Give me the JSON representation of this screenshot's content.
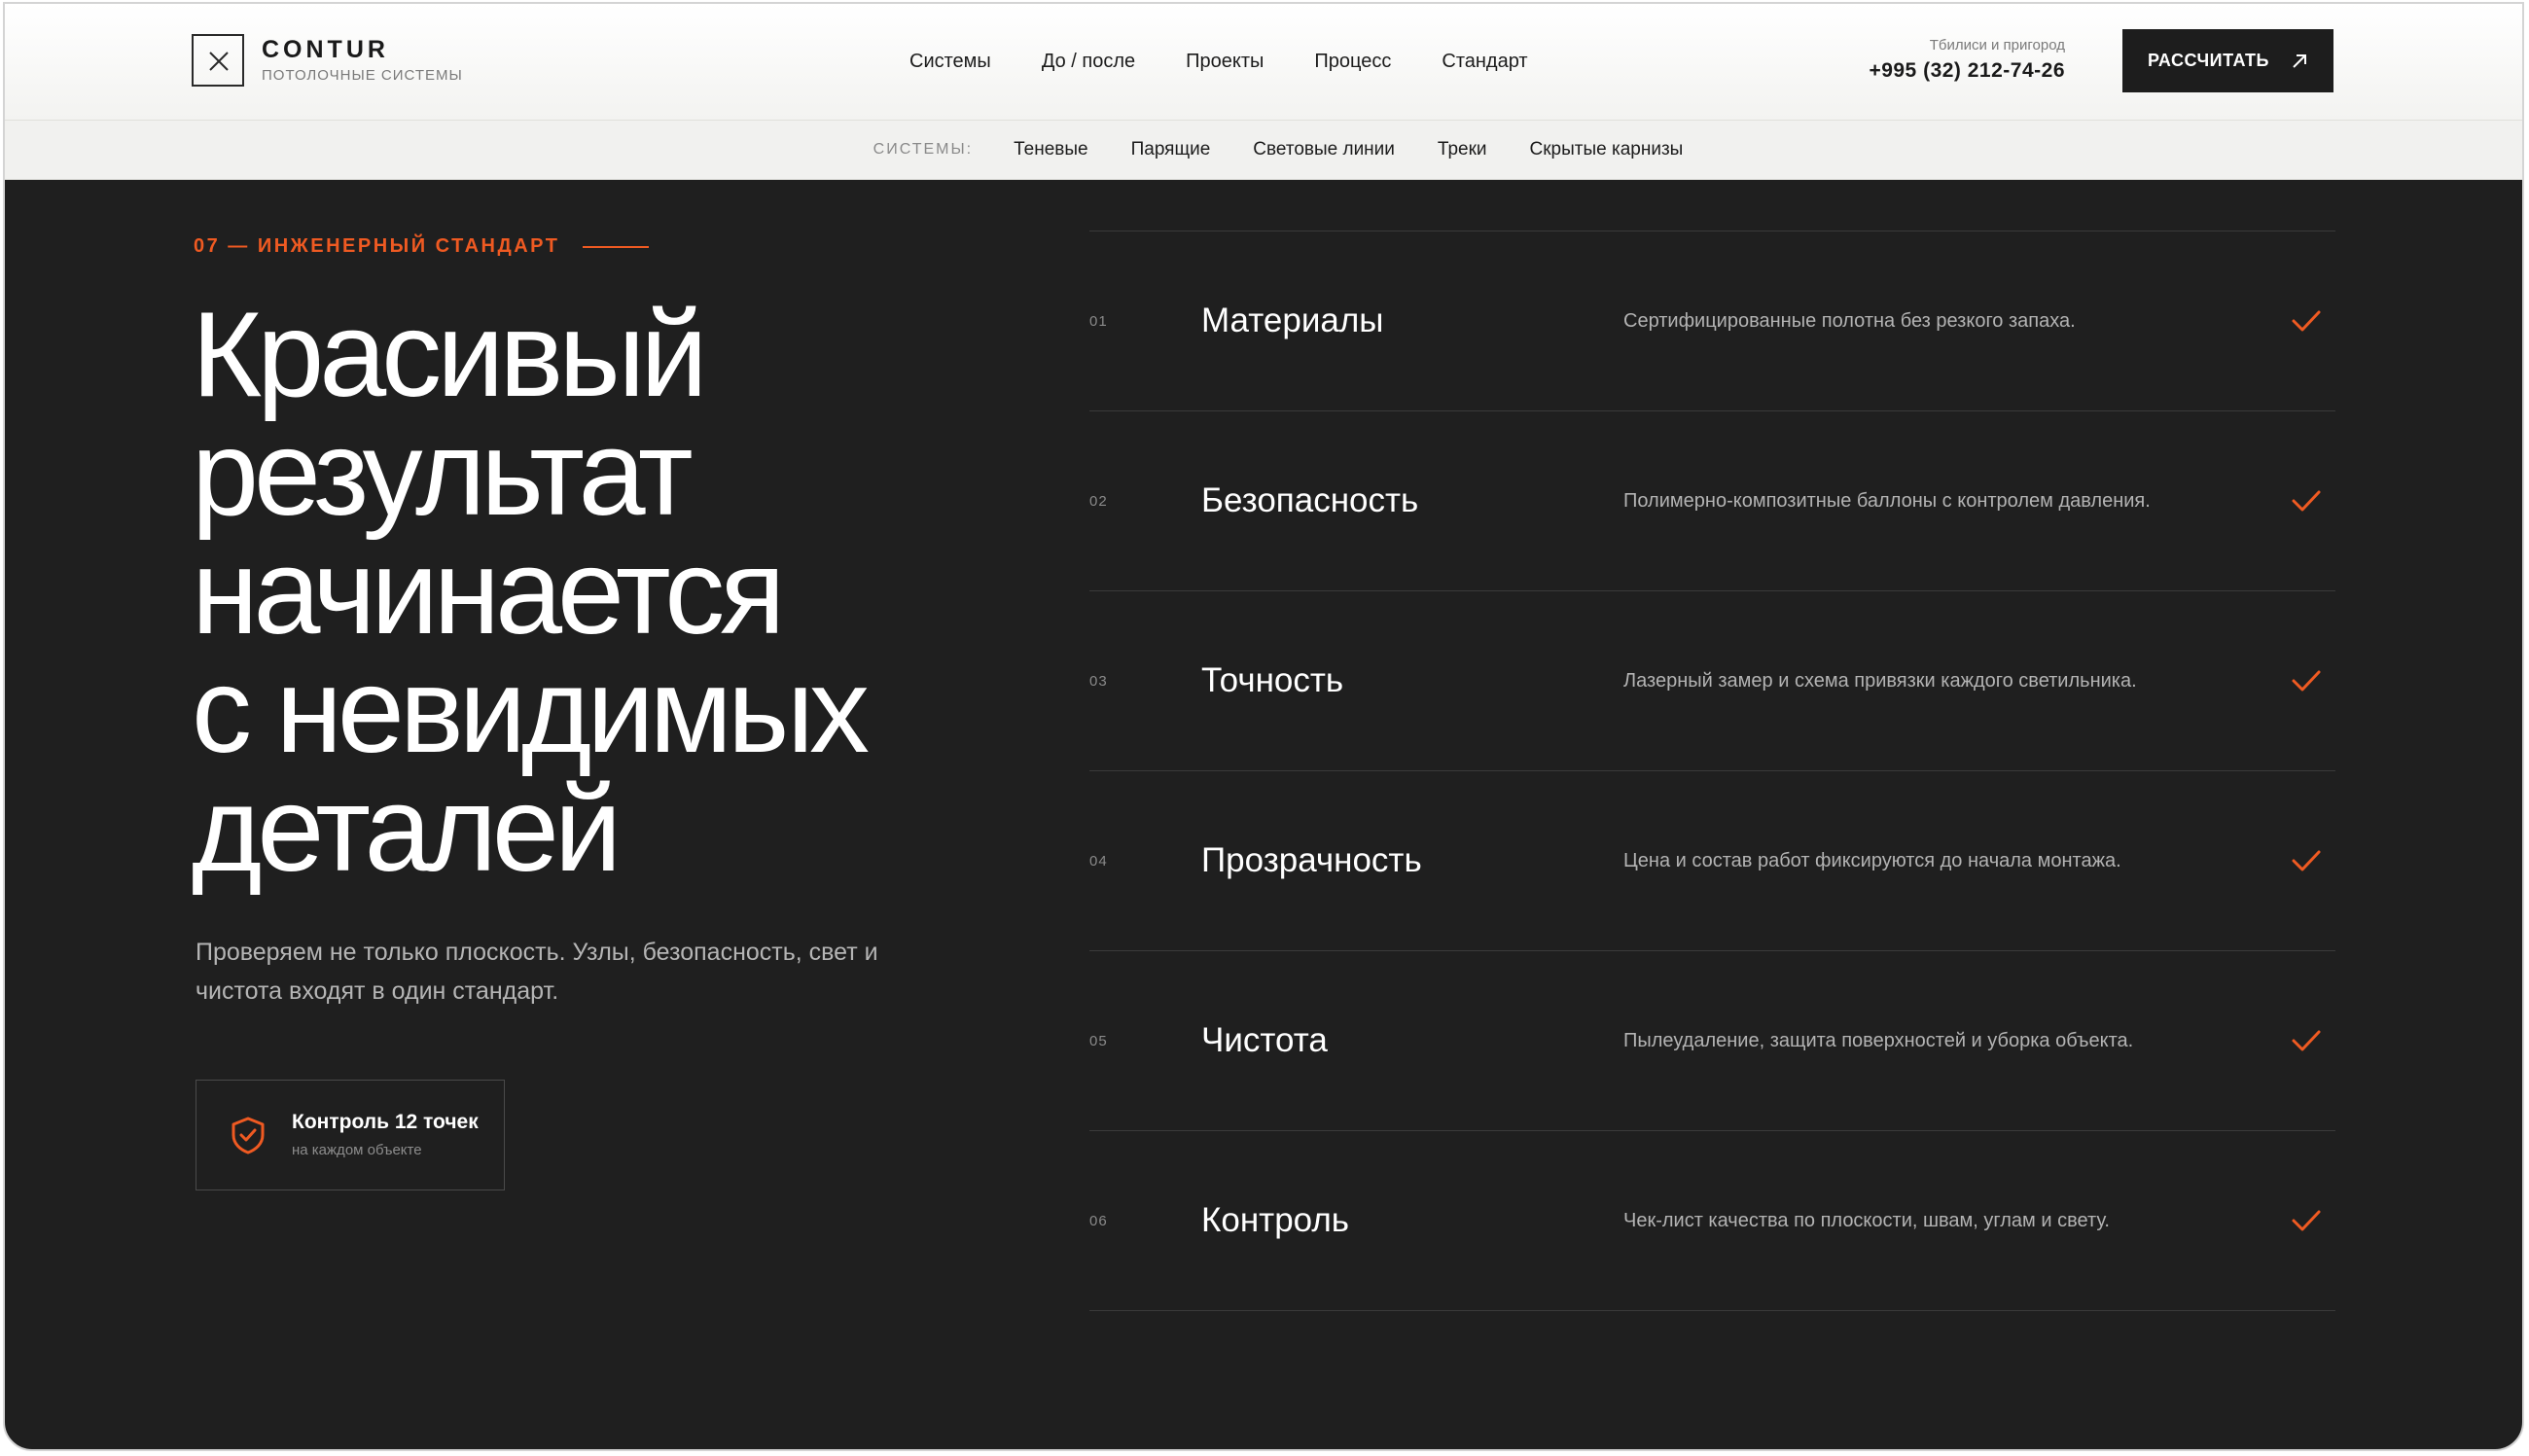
{
  "header": {
    "logo": {
      "name": "CONTUR",
      "subtitle": "ПОТОЛОЧНЫЕ СИСТЕМЫ"
    },
    "nav": [
      "Системы",
      "До / после",
      "Проекты",
      "Процесс",
      "Стандарт"
    ],
    "contact": {
      "city": "Тбилиси и пригород",
      "phone": "+995 (32) 212-74-26"
    },
    "cta_label": "РАССЧИТАТЬ"
  },
  "subnav": {
    "label": "СИСТЕМЫ:",
    "items": [
      "Теневые",
      "Парящие",
      "Световые линии",
      "Треки",
      "Скрытые карнизы"
    ]
  },
  "hero": {
    "eyebrow": "07 — ИНЖЕНЕРНЫЙ СТАНДАРТ",
    "headline": [
      "Красивый",
      "результат",
      "начинается",
      "с невидимых",
      "деталей"
    ],
    "lead": "Проверяем не только плоскость. Узлы, безопасность, свет и чистота входят в один стандарт.",
    "badge": {
      "title": "Контроль 12 точек",
      "subtitle": "на каждом объекте"
    }
  },
  "standards": [
    {
      "num": "01",
      "title": "Материалы",
      "desc": "Сертифицированные полотна без резкого запаха."
    },
    {
      "num": "02",
      "title": "Безопасность",
      "desc": "Полимерно-композитные баллоны с контролем давления."
    },
    {
      "num": "03",
      "title": "Точность",
      "desc": "Лазерный замер и схема привязки каждого светильника."
    },
    {
      "num": "04",
      "title": "Прозрачность",
      "desc": "Цена и состав работ фиксируются до начала монтажа."
    },
    {
      "num": "05",
      "title": "Чистота",
      "desc": "Пылеудаление, защита поверхностей и уборка объекта."
    },
    {
      "num": "06",
      "title": "Контроль",
      "desc": "Чек-лист качества по плоскости, швам, углам и свету."
    }
  ],
  "colors": {
    "accent": "#ef5a22",
    "background": "#1f1f1f",
    "header": "#ffffff"
  },
  "icons": [
    "close-icon",
    "arrow-up-right-icon",
    "shield-check-icon",
    "check-icon"
  ]
}
